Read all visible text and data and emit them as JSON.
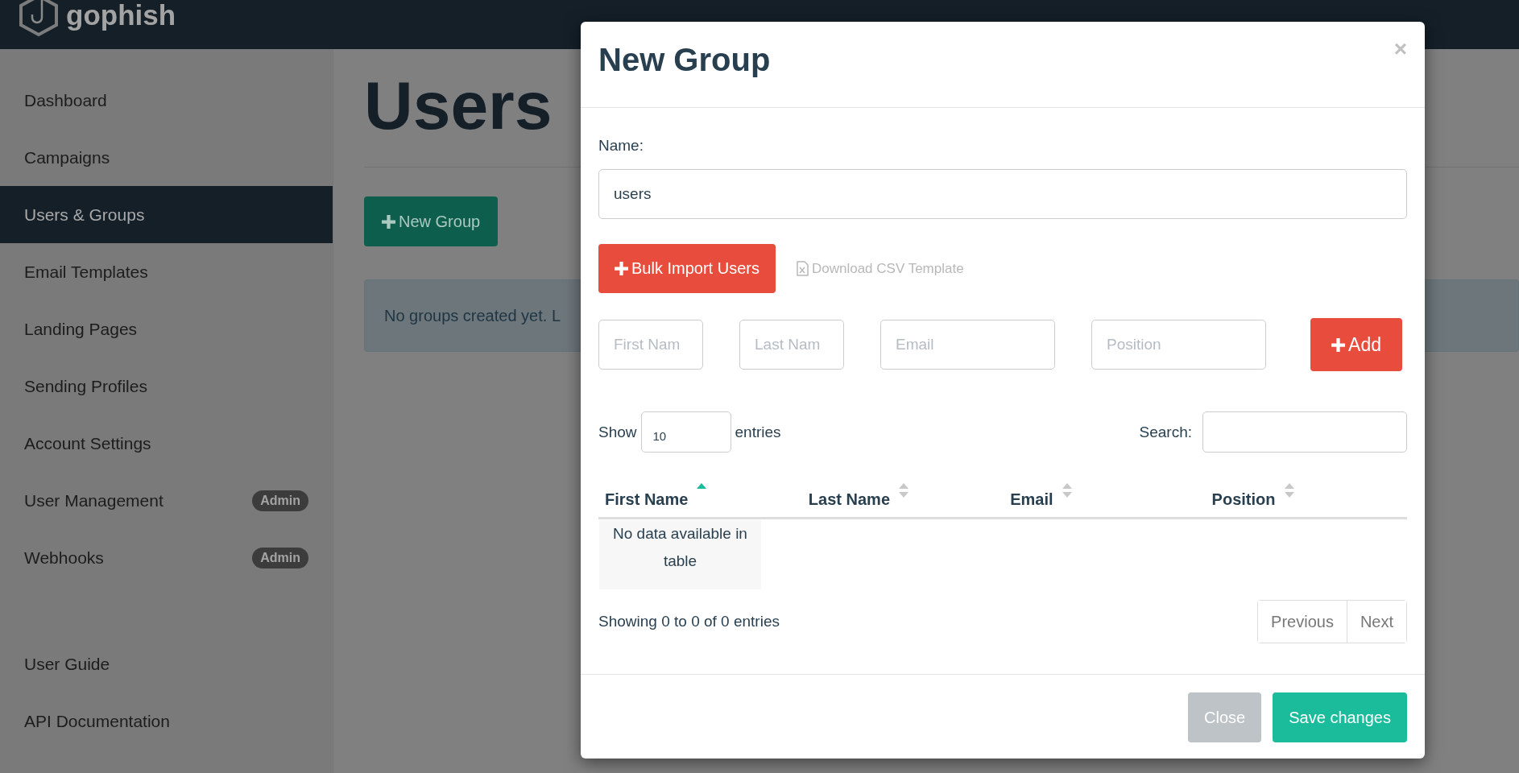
{
  "navbar": {
    "brand": "gophish"
  },
  "sidebar": {
    "items": [
      {
        "label": "Dashboard",
        "selected": false
      },
      {
        "label": "Campaigns",
        "selected": false
      },
      {
        "label": "Users & Groups",
        "selected": true
      },
      {
        "label": "Email Templates",
        "selected": false
      },
      {
        "label": "Landing Pages",
        "selected": false
      },
      {
        "label": "Sending Profiles",
        "selected": false
      },
      {
        "label": "Account Settings",
        "selected": false
      },
      {
        "label": "User Management",
        "selected": false,
        "badge": "Admin"
      },
      {
        "label": "Webhooks",
        "selected": false,
        "badge": "Admin"
      }
    ],
    "footer_items": [
      {
        "label": "User Guide"
      },
      {
        "label": "API Documentation"
      }
    ]
  },
  "page": {
    "title": "Users",
    "new_button": "New Group",
    "alert": "No groups created yet. L"
  },
  "modal": {
    "title": "New Group",
    "close_icon": "×",
    "name_label": "Name:",
    "name_value": "users",
    "bulk_button": "Bulk Import Users",
    "csv_link": "Download CSV Template",
    "fields": [
      {
        "placeholder": "First Nam"
      },
      {
        "placeholder": "Last Nam"
      },
      {
        "placeholder": "Email"
      },
      {
        "placeholder": "Position"
      }
    ],
    "add_button": "Add",
    "show_label": "Show",
    "page_length": "10",
    "entries_label": "entries",
    "search_label": "Search:",
    "columns": [
      {
        "label": "First Name",
        "sorted": true
      },
      {
        "label": "Last Name",
        "sorted": false
      },
      {
        "label": "Email",
        "sorted": false
      },
      {
        "label": "Position",
        "sorted": false
      }
    ],
    "empty_text": "No data available in table",
    "info": "Showing 0 to 0 of 0 entries",
    "pagination": [
      {
        "label": "Previous"
      },
      {
        "label": "Next"
      }
    ],
    "footer_buttons": [
      {
        "label": "Close",
        "kind": "secondary"
      },
      {
        "label": "Save changes",
        "kind": "primary"
      }
    ]
  }
}
